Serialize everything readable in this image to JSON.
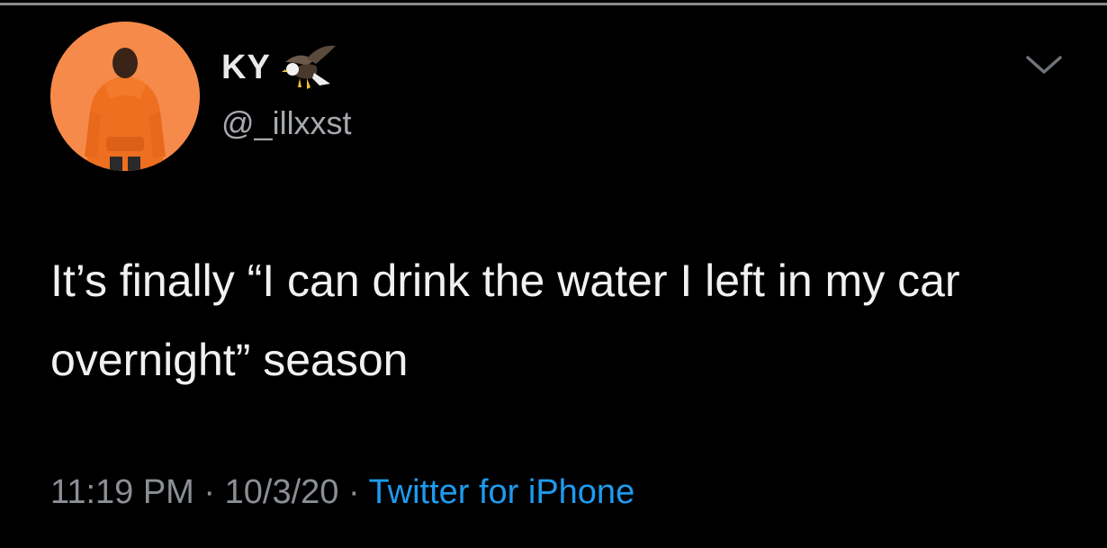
{
  "tweet": {
    "author": {
      "display_name": "KY",
      "badge_icon": "eagle-emoji-icon",
      "handle": "@_illxxst"
    },
    "menu_icon": "chevron-down-icon",
    "text": "It’s finally “I can drink the water I left in my car overnight” season",
    "meta": {
      "time": "11:19 PM",
      "separator_1": " · ",
      "date": "10/3/20",
      "separator_2": " · ",
      "source": "Twitter for iPhone"
    }
  },
  "colors": {
    "background": "#000000",
    "avatar_bg": "#f58a4a",
    "link_blue": "#1d9bf0",
    "muted_text": "#8b8f95"
  }
}
